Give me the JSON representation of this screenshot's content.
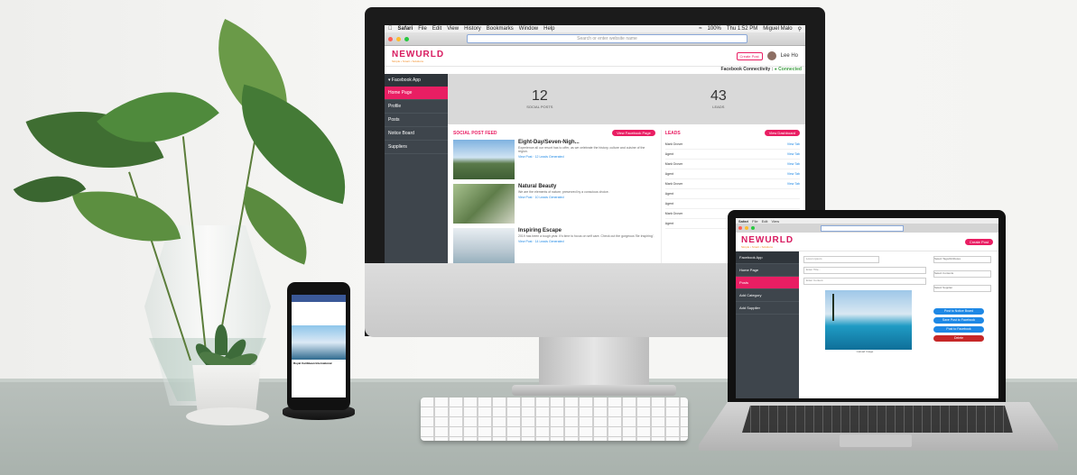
{
  "imac": {
    "menubar": [
      "Safari",
      "File",
      "Edit",
      "View",
      "History",
      "Bookmarks",
      "Window",
      "Help"
    ],
    "status": {
      "battery": "100%",
      "time": "Thu 1:52 PM",
      "user": "Miguel Malo"
    },
    "url_placeholder": "Search or enter website name",
    "app": {
      "logo": "NEWURLD",
      "tagline": "Simple • Smart • Solutions",
      "create_btn": "Create Post",
      "user": "Lee Ho",
      "connectivity_label": "Facebook Connectivity :",
      "connectivity_status": "Connected",
      "sidebar": {
        "section": "Facebook App",
        "items": [
          "Home Page",
          "Profile",
          "Posts",
          "Notice Board",
          "Suppliers"
        ]
      },
      "stats": [
        {
          "value": "12",
          "label": "SOCIAL POSTS"
        },
        {
          "value": "43",
          "label": "LEADS"
        }
      ],
      "feed": {
        "title": "SOCIAL POST FEED",
        "button": "View Facebook Page",
        "posts": [
          {
            "title": "Eight-Day/Seven-Nigh...",
            "text": "Experience all our resort has to offer, as we celebrate the history, culture and cuisine of the region.",
            "link": "View Post · 12 Leads Generated"
          },
          {
            "title": "Natural Beauty",
            "text": "We are the elements of nature, preserved by a conscious choice.",
            "link": "View Post · 10 Leads Generated"
          },
          {
            "title": "Inspiring Escape",
            "text": "2019 has been a tough year. It's time to focus on self care. Check out the gorgeous 'Be Inspiring'.",
            "link": "View Post · 14 Leads Generated"
          }
        ]
      },
      "leads": {
        "title": "LEADS",
        "button": "View Dashboard",
        "rows": [
          {
            "name": "Mark Grover",
            "action": "View Tab"
          },
          {
            "name": "Agent",
            "action": "View Tab"
          },
          {
            "name": "Mark Grover",
            "action": "View Tab"
          },
          {
            "name": "Agent",
            "action": "View Tab"
          },
          {
            "name": "Mark Grover",
            "action": "View Tab"
          },
          {
            "name": "Agent",
            "action": ""
          },
          {
            "name": "Agent",
            "action": ""
          },
          {
            "name": "Mark Grover",
            "action": ""
          },
          {
            "name": "Agent",
            "action": ""
          }
        ]
      }
    }
  },
  "laptop": {
    "sidebar": {
      "section": "Facebook App",
      "items": [
        "Home Page",
        "Posts",
        "Add Category",
        "Add Supplier"
      ]
    },
    "fields": [
      "Lorem ipsum",
      "Enter Title...",
      "Enter Content"
    ],
    "selects": [
      "Select Tags/Attributes",
      "Select Contents",
      "Select Supplier"
    ],
    "caption": "Upload Image",
    "buttons": [
      "Post to Notice Board",
      "Save Post to Facebook",
      "Post to Facebook",
      "Delete"
    ],
    "user_btn": "Create Post"
  },
  "phone": {
    "brand": "Royal Caribbean International"
  },
  "colors": {
    "accent": "#e91e63",
    "sidebar": "#3e454c",
    "link": "#1e88e5",
    "success": "#43a047"
  }
}
